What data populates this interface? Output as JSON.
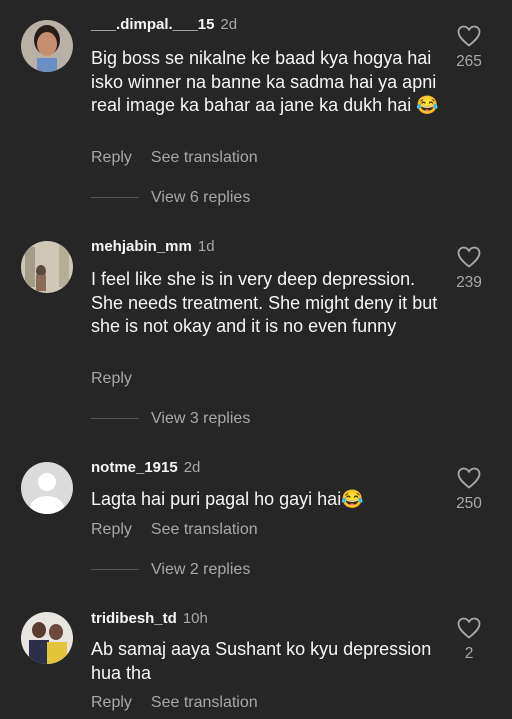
{
  "comments": [
    {
      "username": "___.dimpal.___15",
      "time": "2d",
      "text": "Big boss se nikalne ke baad kya hogya hai isko winner na banne ka sadma hai ya apni real image ka bahar aa jane ka dukh hai 😂",
      "reply": "Reply",
      "translate": "See translation",
      "view_replies": "View 6 replies",
      "likes": "265",
      "avatar_icon": "profile-photo-icon"
    },
    {
      "username": "mehjabin_mm",
      "time": "1d",
      "text": "I feel like she is in very deep depression. She needs treatment. She might deny it but she is not okay and it is no even funny",
      "reply": "Reply",
      "view_replies": "View 3 replies",
      "likes": "239",
      "avatar_icon": "profile-photo-icon"
    },
    {
      "username": "notme_1915",
      "time": "2d",
      "text": "Lagta hai puri pagal ho gayi hai😂",
      "reply": "Reply",
      "translate": "See translation",
      "view_replies": "View 2 replies",
      "likes": "250",
      "avatar_icon": "default-avatar-icon"
    },
    {
      "username": "tridibesh_td",
      "time": "10h",
      "text": "Ab samaj aaya Sushant ko kyu depression hua tha",
      "reply": "Reply",
      "translate": "See translation",
      "likes": "2",
      "avatar_icon": "profile-photo-icon"
    }
  ],
  "colors": {
    "background": "#262626",
    "primary_text": "#f5f5f5",
    "secondary_text": "#a8a8a8"
  },
  "icons": {
    "like": "heart-outline-icon"
  }
}
